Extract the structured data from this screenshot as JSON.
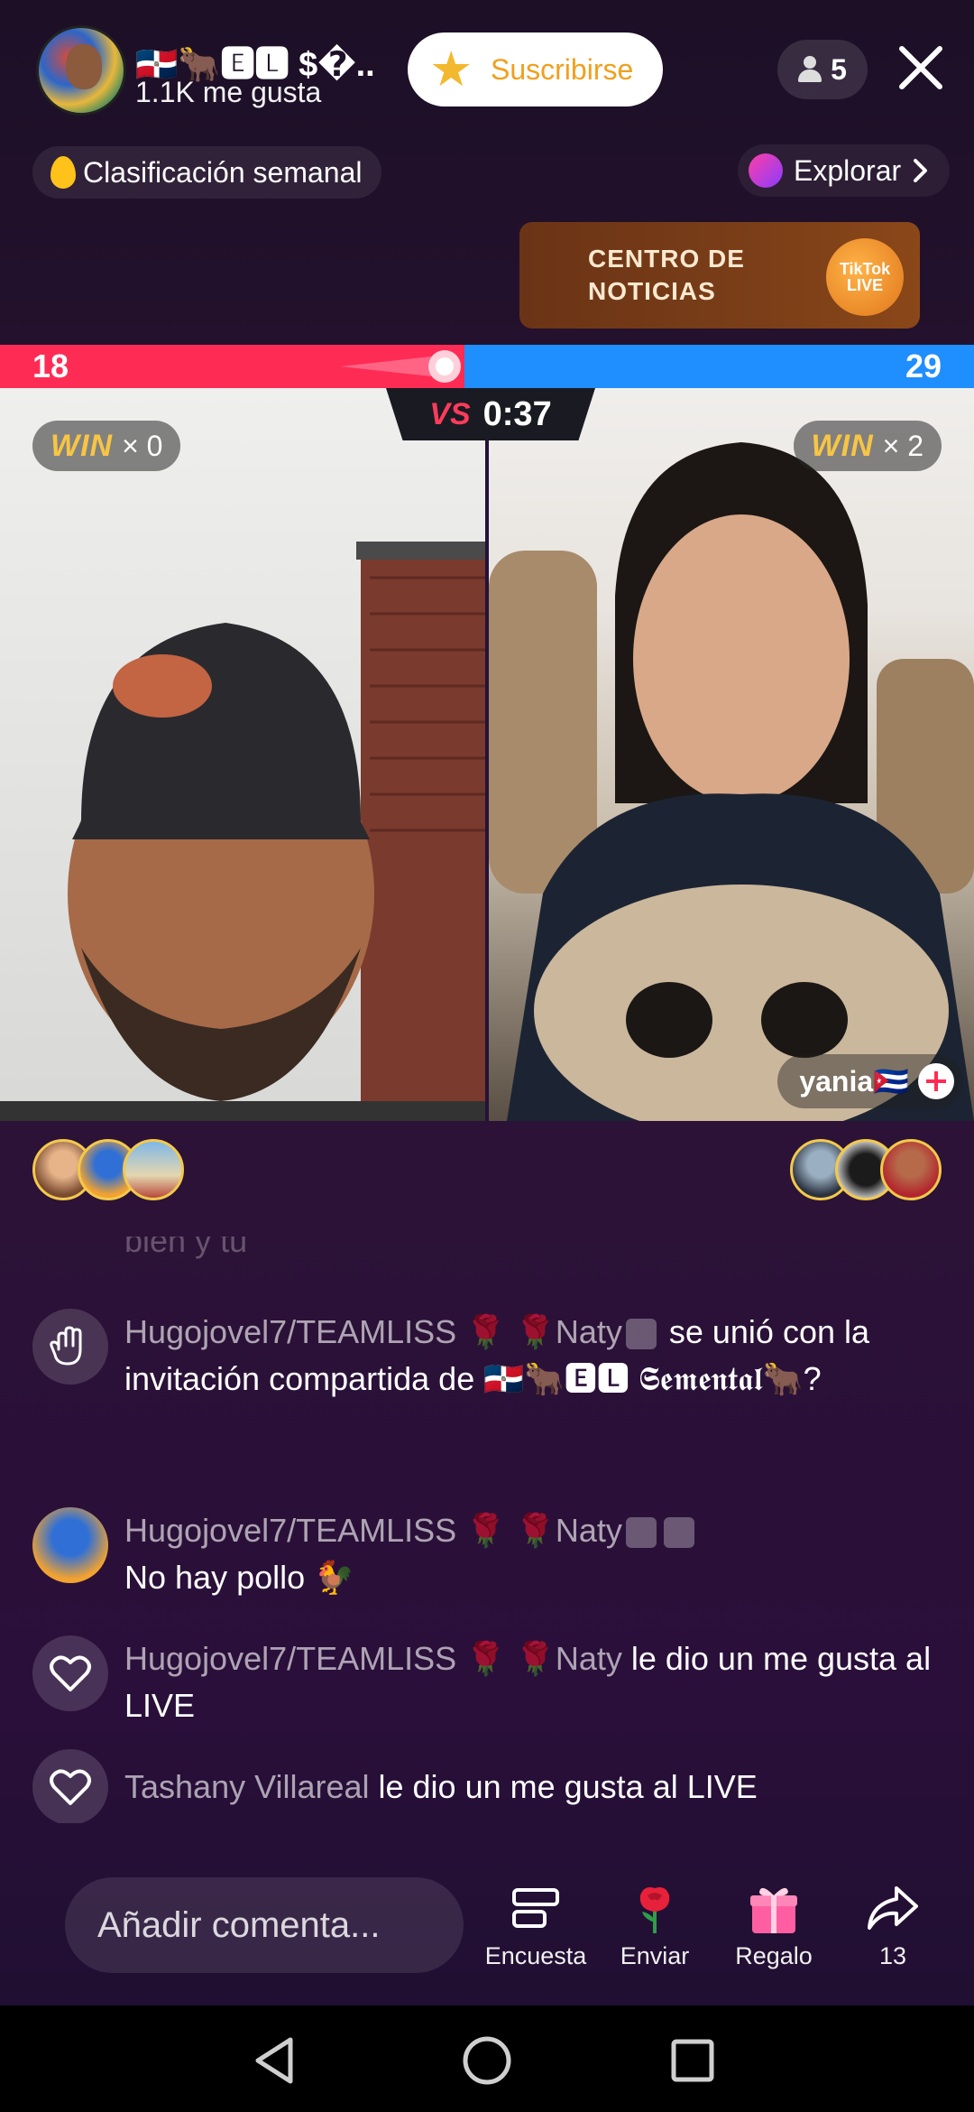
{
  "header": {
    "host_name": "🇩🇴🐂🅴🅻 $�..",
    "likes": "1.1K me gusta",
    "subscribe_label": "Suscribirse",
    "viewer_count": "5",
    "icons": {
      "close": "close-icon",
      "person": "person-icon",
      "star": "star-icon"
    }
  },
  "ranking": {
    "label": "Clasificación semanal"
  },
  "explore": {
    "label": "Explorar"
  },
  "news_banner": {
    "line1": "CENTRO DE",
    "line2": "NOTICIAS",
    "logo_text": "TikTok LIVE"
  },
  "battle": {
    "score_left": "18",
    "score_right": "29",
    "vs": "VS",
    "timer": "0:37",
    "left_win_label": "WIN",
    "left_win_count": "× 0",
    "right_win_label": "WIN",
    "right_win_count": "× 2",
    "opponent_name": "yania🇨🇺",
    "colors": {
      "red": "#fe2c55",
      "blue": "#1f8eff",
      "win_gold": "#f7c545"
    }
  },
  "chat": {
    "faded_line": "bien y tu",
    "messages": [
      {
        "user": "Hugojovel7/TEAMLISS 🌹 🌹Naty",
        "text": " se unió con la invitación compartida de 🇩🇴🐂🅴🅻 𝕾𝖊𝖒𝖊𝖓𝖙𝖆𝖑🐂?"
      },
      {
        "user": "Hugojovel7/TEAMLISS 🌹 🌹Naty",
        "text": "No hay pollo 🐓"
      },
      {
        "user": "Hugojovel7/TEAMLISS 🌹 🌹Naty",
        "text": " le dio un me gusta al LIVE"
      },
      {
        "user": "Tashany Villareal",
        "text": " le dio un me gusta al LIVE"
      }
    ]
  },
  "bottom_bar": {
    "comment_placeholder": "Añadir comenta...",
    "actions": [
      {
        "label": "Encuesta",
        "icon": "poll-icon"
      },
      {
        "label": "Enviar",
        "icon": "rose-icon"
      },
      {
        "label": "Regalo",
        "icon": "gift-icon"
      },
      {
        "label": "13",
        "icon": "share-icon"
      }
    ]
  },
  "system_nav": {
    "back": "back-icon",
    "home": "home-icon",
    "recents": "recents-icon"
  }
}
